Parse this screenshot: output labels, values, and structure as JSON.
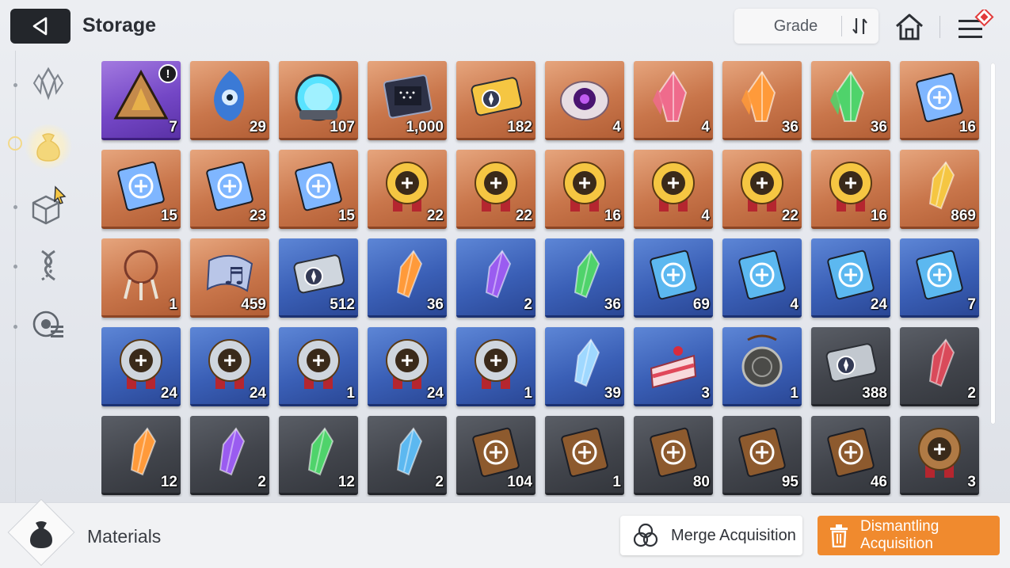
{
  "header": {
    "title": "Storage",
    "grade_label": "Grade"
  },
  "sidebar": {
    "items": [
      {
        "icon": "crystal-icon",
        "active": false
      },
      {
        "icon": "material-pouch-icon",
        "active": true
      },
      {
        "icon": "cube-icon",
        "active": false
      },
      {
        "icon": "dna-icon",
        "active": false
      },
      {
        "icon": "target-list-icon",
        "active": false
      }
    ]
  },
  "colors": {
    "accent": "#f08a2e",
    "orange_grade": "#c9764b",
    "purple_grade": "#7447c6",
    "blue_grade": "#3a5fb6",
    "gray_grade": "#41444b"
  },
  "items": [
    {
      "icon": "triangle-device-icon",
      "grade": "purple",
      "qty": "7",
      "alert": true
    },
    {
      "icon": "blue-flame-creature-icon",
      "grade": "orange",
      "qty": "29"
    },
    {
      "icon": "energy-orb-icon",
      "grade": "orange",
      "qty": "107"
    },
    {
      "icon": "data-chip-icon",
      "grade": "orange",
      "qty": "1,000"
    },
    {
      "icon": "gold-ticket-icon",
      "grade": "orange",
      "qty": "182"
    },
    {
      "icon": "purple-eye-core-icon",
      "grade": "orange",
      "qty": "4"
    },
    {
      "icon": "pink-crystal-icon",
      "grade": "orange",
      "qty": "4"
    },
    {
      "icon": "orange-crystal-icon",
      "grade": "orange",
      "qty": "36"
    },
    {
      "icon": "green-crystal-icon",
      "grade": "orange",
      "qty": "36"
    },
    {
      "icon": "skill-book-sword-icon",
      "grade": "orange",
      "qty": "16"
    },
    {
      "icon": "skill-book-shield-icon",
      "grade": "orange",
      "qty": "15"
    },
    {
      "icon": "skill-book-bolt-icon",
      "grade": "orange",
      "qty": "23"
    },
    {
      "icon": "skill-book-target-icon",
      "grade": "orange",
      "qty": "15"
    },
    {
      "icon": "gold-medal-sword-icon",
      "grade": "orange",
      "qty": "22"
    },
    {
      "icon": "gold-medal-shield-icon",
      "grade": "orange",
      "qty": "22"
    },
    {
      "icon": "gold-medal-eye-icon",
      "grade": "orange",
      "qty": "16"
    },
    {
      "icon": "gold-medal-blade-icon",
      "grade": "orange",
      "qty": "4"
    },
    {
      "icon": "gold-medal-bolt-icon",
      "grade": "orange",
      "qty": "22"
    },
    {
      "icon": "gold-medal-target-icon",
      "grade": "orange",
      "qty": "16"
    },
    {
      "icon": "gold-shards-icon",
      "grade": "orange",
      "qty": "869"
    },
    {
      "icon": "dreamcatcher-icon",
      "grade": "orange",
      "qty": "1"
    },
    {
      "icon": "music-scroll-icon",
      "grade": "orange",
      "qty": "459"
    },
    {
      "icon": "silver-ticket-icon",
      "grade": "blue",
      "qty": "512"
    },
    {
      "icon": "orange-shard-icon",
      "grade": "blue",
      "qty": "36"
    },
    {
      "icon": "purple-shard-icon",
      "grade": "blue",
      "qty": "2"
    },
    {
      "icon": "green-shard-icon",
      "grade": "blue",
      "qty": "36"
    },
    {
      "icon": "blue-book-sword-icon",
      "grade": "blue",
      "qty": "69"
    },
    {
      "icon": "blue-book-eye-icon",
      "grade": "blue",
      "qty": "4"
    },
    {
      "icon": "blue-book-bolt-icon",
      "grade": "blue",
      "qty": "24"
    },
    {
      "icon": "blue-book-target-icon",
      "grade": "blue",
      "qty": "7"
    },
    {
      "icon": "silver-medal-sword-icon",
      "grade": "blue",
      "qty": "24"
    },
    {
      "icon": "silver-medal-shield-icon",
      "grade": "blue",
      "qty": "24"
    },
    {
      "icon": "silver-medal-eye-icon",
      "grade": "blue",
      "qty": "1"
    },
    {
      "icon": "silver-medal-bolt-icon",
      "grade": "blue",
      "qty": "24"
    },
    {
      "icon": "silver-medal-target-icon",
      "grade": "blue",
      "qty": "1"
    },
    {
      "icon": "ice-crystal-icon",
      "grade": "blue",
      "qty": "39"
    },
    {
      "icon": "cake-slice-icon",
      "grade": "blue",
      "qty": "3"
    },
    {
      "icon": "pocket-watch-icon",
      "grade": "blue",
      "qty": "1"
    },
    {
      "icon": "gray-ticket-icon",
      "grade": "gray",
      "qty": "388"
    },
    {
      "icon": "red-shard-gray-icon",
      "grade": "gray",
      "qty": "2"
    },
    {
      "icon": "orange-shard-gray-icon",
      "grade": "gray",
      "qty": "12"
    },
    {
      "icon": "purple-shard-gray-icon",
      "grade": "gray",
      "qty": "2"
    },
    {
      "icon": "green-shard-gray-icon",
      "grade": "gray",
      "qty": "12"
    },
    {
      "icon": "blue-shard-gray-icon",
      "grade": "gray",
      "qty": "2"
    },
    {
      "icon": "brown-book-sword-icon",
      "grade": "gray",
      "qty": "104"
    },
    {
      "icon": "brown-book-shield-icon",
      "grade": "gray",
      "qty": "1"
    },
    {
      "icon": "brown-book-eye-icon",
      "grade": "gray",
      "qty": "80"
    },
    {
      "icon": "brown-book-blade-icon",
      "grade": "gray",
      "qty": "95"
    },
    {
      "icon": "brown-book-target-icon",
      "grade": "gray",
      "qty": "46"
    },
    {
      "icon": "bronze-medal-sword-icon",
      "grade": "gray",
      "qty": "3"
    }
  ],
  "footer": {
    "category_label": "Materials",
    "merge_label": "Merge Acquisition",
    "dismantle_label": "Dismantling Acquisition"
  }
}
